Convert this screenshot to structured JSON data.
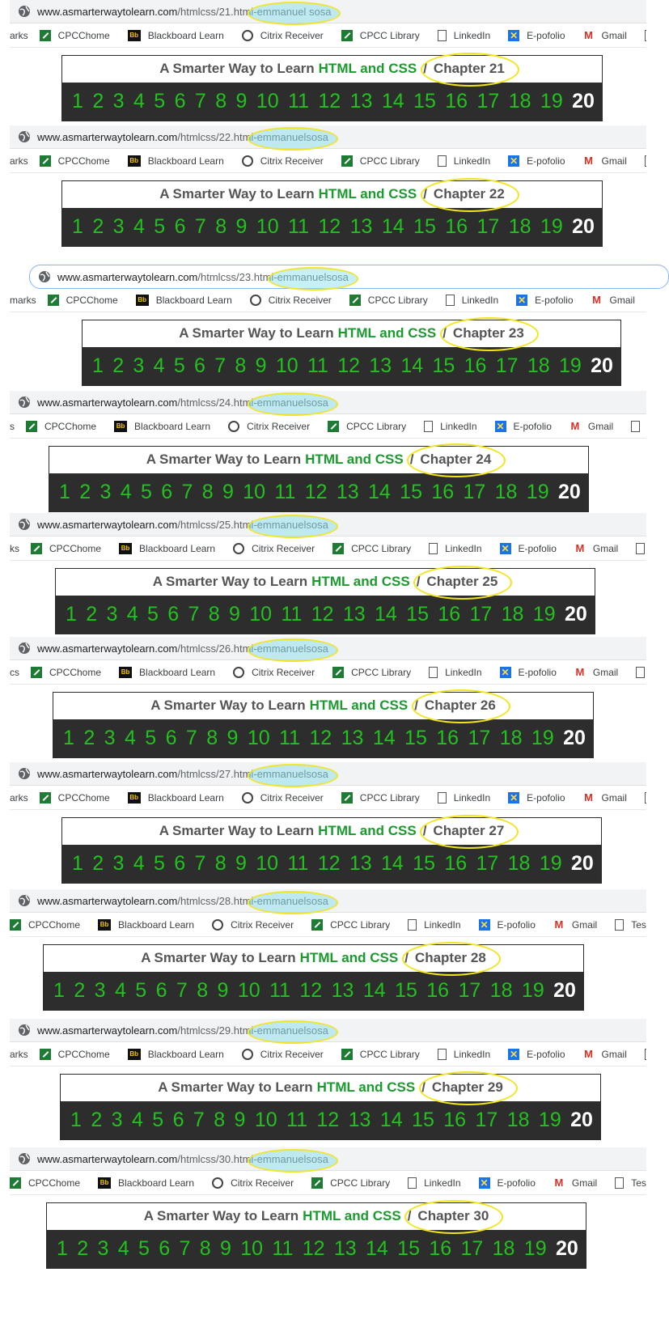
{
  "common": {
    "domain_text": "www.asmarterwaytolearn.com",
    "site_title_prefix": "A Smarter Way to Learn",
    "site_title_highlight": "HTML and CSS",
    "separator": "/",
    "chapter_numbers": [
      "1",
      "2",
      "3",
      "4",
      "5",
      "6",
      "7",
      "8",
      "9",
      "10",
      "11",
      "12",
      "13",
      "14",
      "15",
      "16",
      "17",
      "18",
      "19",
      "20"
    ],
    "current_chapter_number": "20",
    "bookmarks": [
      {
        "label": "CPCChome",
        "icon": "cpcc-icon"
      },
      {
        "label": "Blackboard Learn",
        "icon": "blackboard-icon"
      },
      {
        "label": "Citrix Receiver",
        "icon": "citrix-icon"
      },
      {
        "label": "CPCC Library",
        "icon": "cpcc-icon"
      },
      {
        "label": "LinkedIn",
        "icon": "page-icon"
      },
      {
        "label": "E-pofolio",
        "icon": "eportfolio-icon"
      },
      {
        "label": "Gmail",
        "icon": "gmail-icon"
      },
      {
        "label": "TestOut",
        "icon": "page-icon"
      }
    ],
    "colors": {
      "green_text": "#1a9b2e",
      "number_green": "#21c21d",
      "nav_bg": "#2d2d2d",
      "highlight_yellow": "#f2e61a"
    }
  },
  "panels": [
    {
      "url_path": "/htmlcss/21.html",
      "tag": "emmanuel sosa",
      "chapter": "Chapter 21",
      "bm_lead": "arks"
    },
    {
      "url_path": "/htmlcss/22.html",
      "tag": "emmanuelsosa",
      "chapter": "Chapter 22",
      "bm_lead": "arks"
    },
    {
      "url_path": "/htmlcss/23.html",
      "tag": "emmanuelsosa",
      "chapter": "Chapter 23",
      "bm_lead": "marks"
    },
    {
      "url_path": "/htmlcss/24.html",
      "tag": "emmanuelsosa",
      "chapter": "Chapter 24",
      "bm_lead": "s"
    },
    {
      "url_path": "/htmlcss/25.html",
      "tag": "emmanuelsosa",
      "chapter": "Chapter 25",
      "bm_lead": "ks"
    },
    {
      "url_path": "/htmlcss/26.html",
      "tag": "emmanuelsosa",
      "chapter": "Chapter 26",
      "bm_lead": "cs"
    },
    {
      "url_path": "/htmlcss/27.html",
      "tag": "emmanuelsosa",
      "chapter": "Chapter 27",
      "bm_lead": "arks"
    },
    {
      "url_path": "/htmlcss/28.html",
      "tag": "emmanuelsosa",
      "chapter": "Chapter 28",
      "bm_lead": ""
    },
    {
      "url_path": "/htmlcss/29.html",
      "tag": "emmanuelsosa",
      "chapter": "Chapter 29",
      "bm_lead": "arks"
    },
    {
      "url_path": "/htmlcss/30.html",
      "tag": "emmanuelsosa",
      "chapter": "Chapter 30",
      "bm_lead": ""
    }
  ]
}
